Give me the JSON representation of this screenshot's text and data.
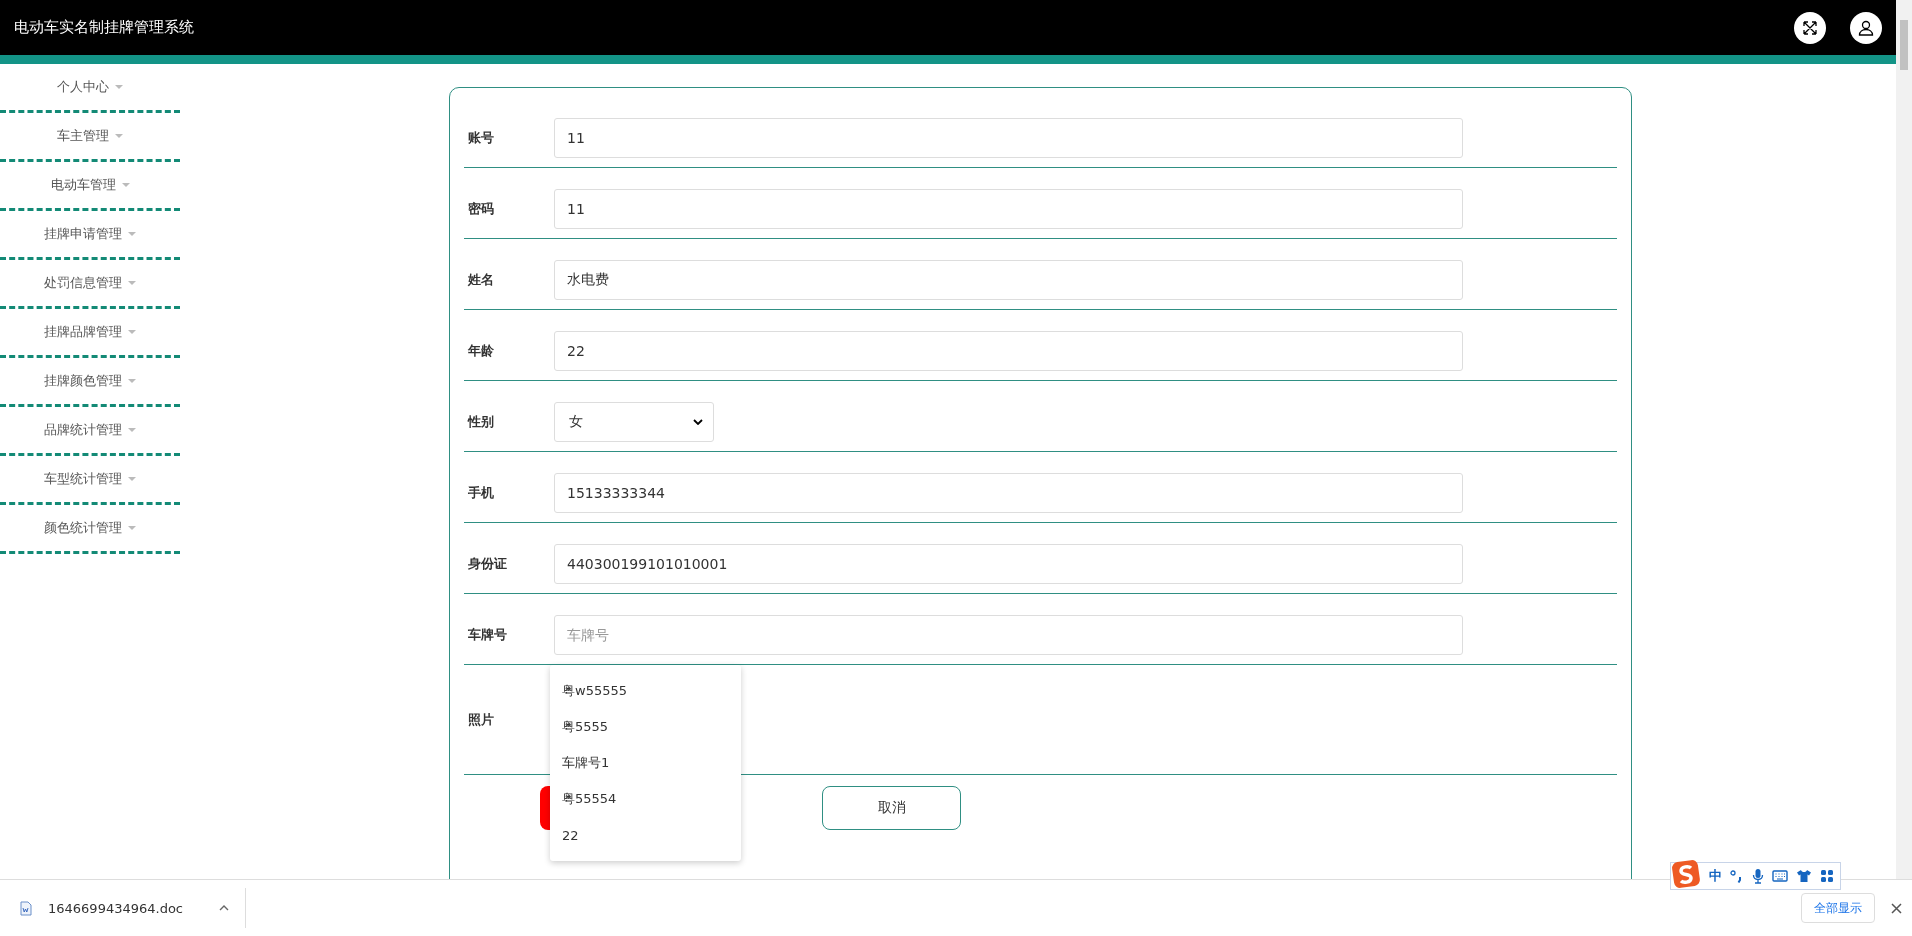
{
  "header": {
    "title": "电动车实名制挂牌管理系统"
  },
  "sidebar": {
    "items": [
      {
        "label": "个人中心",
        "expanded": false
      },
      {
        "label": "车主管理",
        "expanded": false
      },
      {
        "label": "电动车管理",
        "expanded": false
      },
      {
        "label": "挂牌申请管理",
        "expanded": false
      },
      {
        "label": "处罚信息管理",
        "expanded": false
      },
      {
        "label": "挂牌品牌管理",
        "expanded": false
      },
      {
        "label": "挂牌颜色管理",
        "expanded": false
      },
      {
        "label": "品牌统计管理",
        "expanded": false
      },
      {
        "label": "车型统计管理",
        "expanded": false
      },
      {
        "label": "颜色统计管理",
        "expanded": false
      }
    ]
  },
  "form": {
    "fields": [
      {
        "kind": "text",
        "label": "账号",
        "value": "11"
      },
      {
        "kind": "text",
        "label": "密码",
        "value": "11"
      },
      {
        "kind": "text",
        "label": "姓名",
        "value": "水电费"
      },
      {
        "kind": "text",
        "label": "年龄",
        "value": "22"
      },
      {
        "kind": "select",
        "label": "性别",
        "value": "女"
      },
      {
        "kind": "text",
        "label": "手机",
        "value": "15133333344"
      },
      {
        "kind": "text",
        "label": "身份证",
        "value": "440300199101010001"
      },
      {
        "kind": "autocomplete",
        "label": "车牌号",
        "placeholder": "车牌号",
        "suggestions": [
          "粤w55555",
          "粤5555",
          "车牌号1",
          "粤55554",
          "22"
        ]
      },
      {
        "kind": "photo",
        "label": "照片"
      }
    ],
    "buttons": [
      {
        "kind": "primary"
      },
      {
        "kind": "secondary",
        "label": "取消"
      }
    ]
  },
  "ime_toolbar": {
    "mode": "中"
  },
  "download_bar": {
    "file": "1646699434964.doc",
    "show_all": "全部显示"
  }
}
